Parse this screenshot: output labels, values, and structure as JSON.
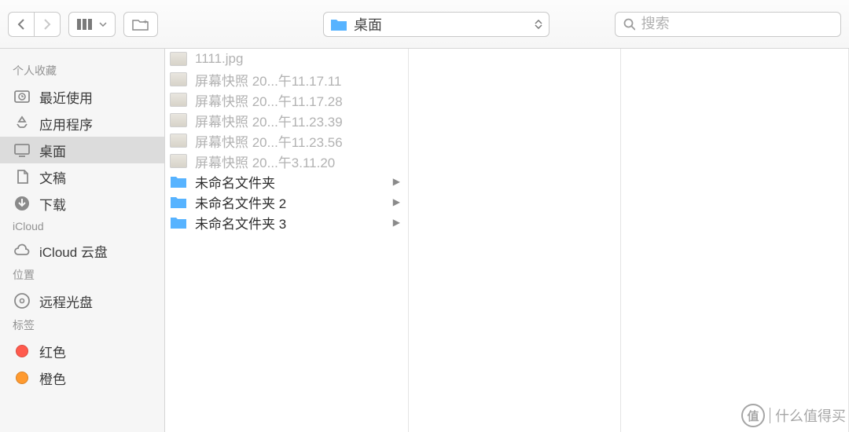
{
  "toolbar": {
    "path_title": "桌面",
    "search_placeholder": "搜索"
  },
  "sidebar": {
    "sections": [
      {
        "header": "个人收藏",
        "items": [
          {
            "icon": "clock-icon",
            "label": "最近使用"
          },
          {
            "icon": "apps-icon",
            "label": "应用程序"
          },
          {
            "icon": "desktop-icon",
            "label": "桌面",
            "selected": true
          },
          {
            "icon": "documents-icon",
            "label": "文稿"
          },
          {
            "icon": "downloads-icon",
            "label": "下载"
          }
        ]
      },
      {
        "header": "iCloud",
        "items": [
          {
            "icon": "cloud-icon",
            "label": "iCloud 云盘"
          }
        ]
      },
      {
        "header": "位置",
        "items": [
          {
            "icon": "disc-icon",
            "label": "远程光盘"
          }
        ]
      },
      {
        "header": "标签",
        "items": [
          {
            "icon": "tag-dot",
            "color": "#ff5a4d",
            "label": "红色"
          },
          {
            "icon": "tag-dot",
            "color": "#ff9a2f",
            "label": "橙色"
          }
        ]
      }
    ]
  },
  "files": [
    {
      "type": "image",
      "name": "1111.jpg",
      "dim": true
    },
    {
      "type": "image",
      "name": "屏幕快照 20...午11.17.11",
      "dim": true
    },
    {
      "type": "image",
      "name": "屏幕快照 20...午11.17.28",
      "dim": true
    },
    {
      "type": "image",
      "name": "屏幕快照 20...午11.23.39",
      "dim": true
    },
    {
      "type": "image",
      "name": "屏幕快照 20...午11.23.56",
      "dim": true
    },
    {
      "type": "image",
      "name": "屏幕快照 20...午3.11.20",
      "dim": true
    },
    {
      "type": "folder",
      "name": "未命名文件夹",
      "arrow": true
    },
    {
      "type": "folder",
      "name": "未命名文件夹 2",
      "arrow": true
    },
    {
      "type": "folder",
      "name": "未命名文件夹 3",
      "arrow": true
    }
  ],
  "watermark": {
    "badge": "值",
    "text": "什么值得买"
  }
}
